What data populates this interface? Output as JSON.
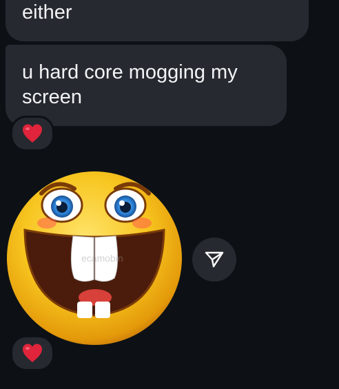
{
  "messages": [
    {
      "text": "either"
    },
    {
      "lines": [
        "u hard core mogging my",
        "screen"
      ]
    }
  ],
  "reactions": {
    "message": "❤️",
    "sticker": "❤️"
  },
  "sticker": {
    "watermark": "ecamobin",
    "icon": "laughing-emoji-sticker"
  },
  "share": {
    "icon": "send-icon"
  },
  "colors": {
    "background": "#0d1116",
    "bubble": "#262a30",
    "text": "#f2f3f5",
    "heart": "#e0243b"
  }
}
